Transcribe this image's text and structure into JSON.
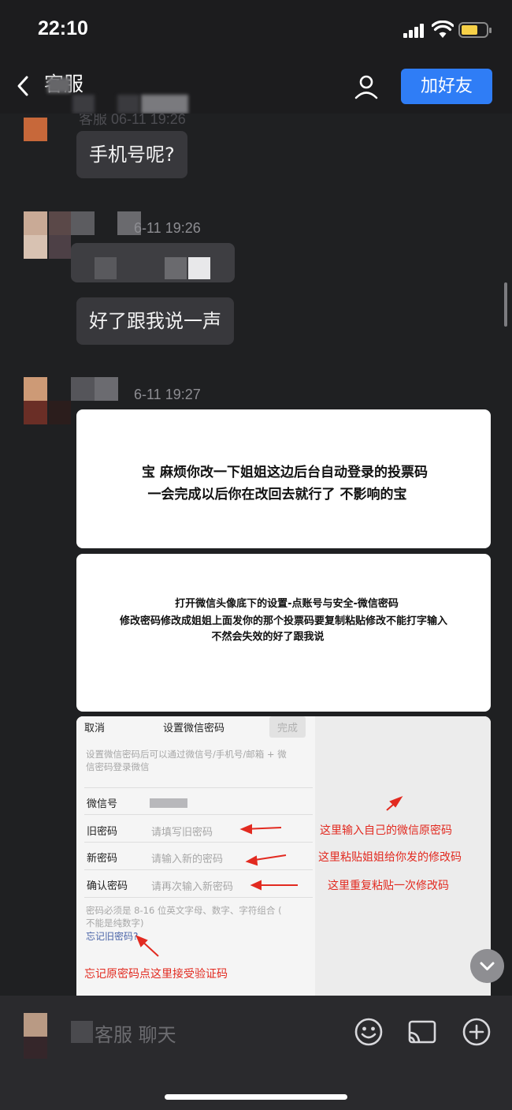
{
  "status_bar": {
    "time": "22:10"
  },
  "nav": {
    "title": "客服",
    "add_friend_label": "加好友"
  },
  "messages": [
    {
      "meta": "客服 06-11 19:26",
      "text": "手机号呢?"
    },
    {
      "meta": "6-11 19:26",
      "text": "好了跟我说一声"
    },
    {
      "meta": "6-11 19:27"
    }
  ],
  "image_cards": {
    "card1": {
      "line1": "宝 麻烦你改一下姐姐这边后台自动登录的投票码",
      "line2": "一会完成以后你在改回去就行了 不影响的宝"
    },
    "card2": {
      "line1": "打开微信头像底下的设置-点账号与安全-微信密码",
      "line2": "修改密码修改成姐姐上面发你的那个投票码要复制粘贴修改不能打字输入",
      "line3": "不然会失效的好了跟我说"
    }
  },
  "settings_screenshot": {
    "cancel": "取消",
    "title": "设置微信密码",
    "done": "完成",
    "description_1": "设置微信密码后可以通过微信号/手机号/邮箱 + 微",
    "description_2": "信密码登录微信",
    "wechat_id_label": "微信号",
    "old_password_label": "旧密码",
    "old_password_placeholder": "请填写旧密码",
    "new_password_label": "新密码",
    "new_password_placeholder": "请输入新的密码",
    "confirm_password_label": "确认密码",
    "confirm_password_placeholder": "请再次输入新密码",
    "rule_1": "密码必须是 8-16 位英文字母、数字、字符组合 (",
    "rule_2": "不能是纯数字)",
    "forgot_link": "忘记旧密码?",
    "annotation_old": "这里输入自己的微信原密码",
    "annotation_new": "这里粘贴姐姐给你发的修改码",
    "annotation_confirm": "这里重复粘贴一次修改码",
    "annotation_forgot": "忘记原密码点这里接受验证码"
  },
  "input_bar": {
    "placeholder": "客服 聊天"
  },
  "icons": [
    "back-icon",
    "profile-icon",
    "chevron-down-icon",
    "emoji-icon",
    "screen-cast-icon",
    "plus-icon"
  ]
}
